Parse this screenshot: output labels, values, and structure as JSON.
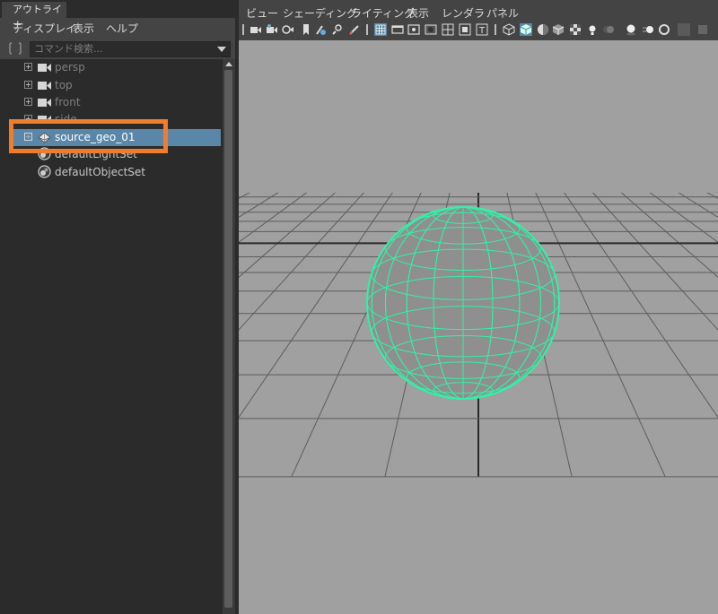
{
  "outliner": {
    "tab_title": "アウトライナ",
    "menus": [
      "ディスプレイ",
      "表示",
      "ヘルプ"
    ],
    "search": {
      "placeholder": "コマンド検索..."
    },
    "items": [
      {
        "label": "persp",
        "type": "camera"
      },
      {
        "label": "top",
        "type": "camera"
      },
      {
        "label": "front",
        "type": "camera"
      },
      {
        "label": "side",
        "type": "camera"
      },
      {
        "label": "source_geo_01",
        "type": "mesh",
        "selected": true
      },
      {
        "label": "defaultLightSet",
        "type": "set"
      },
      {
        "label": "defaultObjectSet",
        "type": "set"
      }
    ]
  },
  "viewport": {
    "menus": [
      "ビュー",
      "シェーディング",
      "ライティング",
      "表示",
      "レンダラ",
      "パネル"
    ]
  },
  "colors": {
    "selection_row": "#5a86a8",
    "highlight_box": "#f07d2c",
    "wireframe": "#34f0a6",
    "canvas_bg": "#a0a0a0"
  }
}
